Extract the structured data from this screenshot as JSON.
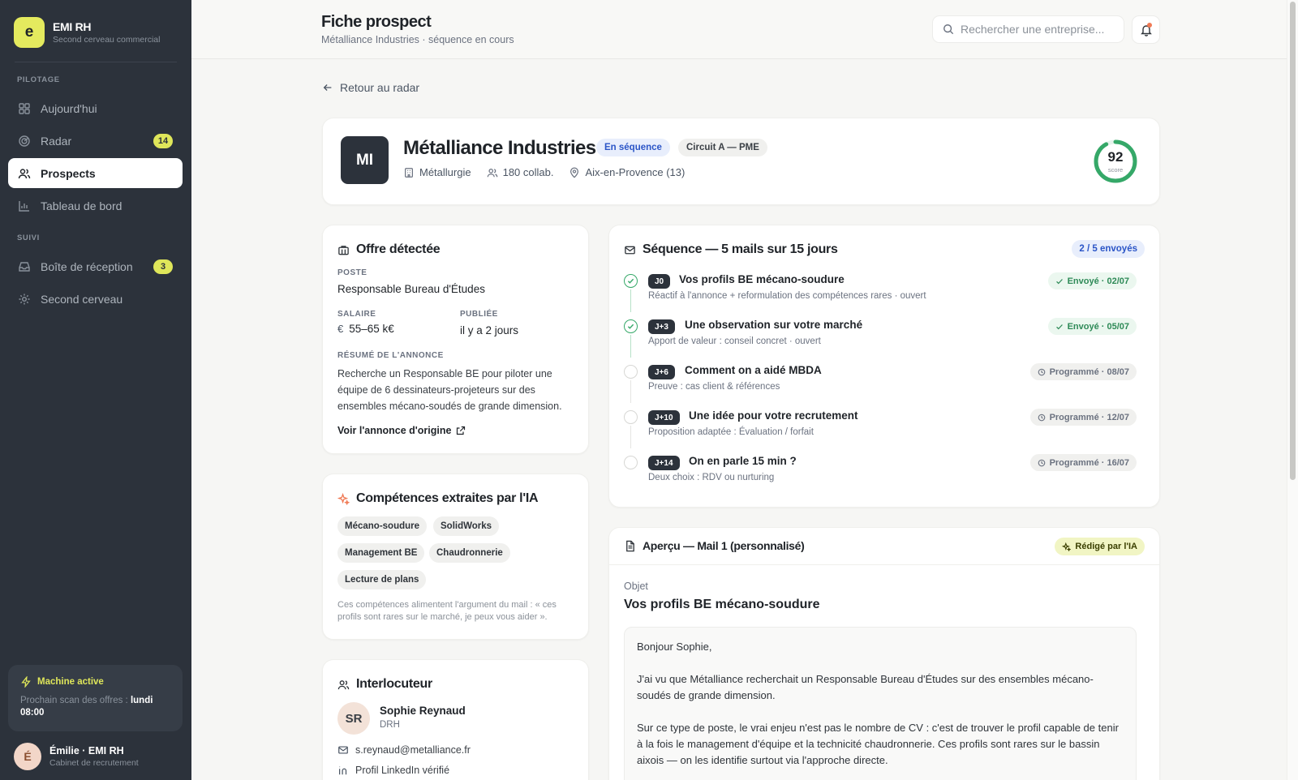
{
  "app": {
    "logo_letter": "e",
    "name": "EMI RH",
    "tagline": "Second cerveau commercial"
  },
  "sidebar": {
    "sections": [
      {
        "label": "PILOTAGE",
        "items": [
          {
            "label": "Aujourd'hui",
            "icon": "grid-icon"
          },
          {
            "label": "Radar",
            "icon": "radar-icon",
            "badge": "14"
          },
          {
            "label": "Prospects",
            "icon": "users-icon",
            "active": true
          },
          {
            "label": "Tableau de bord",
            "icon": "chart-icon"
          }
        ]
      },
      {
        "label": "SUIVI",
        "items": [
          {
            "label": "Boîte de réception",
            "icon": "inbox-icon",
            "badge": "3"
          },
          {
            "label": "Second cerveau",
            "icon": "gear-icon"
          }
        ]
      }
    ],
    "machine": {
      "title": "Machine active",
      "text": "Prochain scan des offres :",
      "time": "lundi 08:00"
    },
    "user": {
      "initial": "É",
      "name": "Émilie · EMI RH",
      "role": "Cabinet de recrutement"
    }
  },
  "header": {
    "title": "Fiche prospect",
    "subtitle": "Métalliance Industries · séquence en cours",
    "search_placeholder": "Rechercher une entreprise..."
  },
  "back_label": "Retour au radar",
  "company": {
    "initials": "MI",
    "name": "Métalliance Industries",
    "status_pill": "En séquence",
    "circuit_pill": "Circuit A — PME",
    "sector": "Métallurgie",
    "employees": "180 collab.",
    "location": "Aix-en-Provence (13)",
    "score": 92,
    "score_label": "score",
    "score_color": "#35a868"
  },
  "offer": {
    "title": "Offre détectée",
    "poste_label": "POSTE",
    "poste": "Responsable Bureau d'Études",
    "salaire_label": "SALAIRE",
    "salaire": "55–65 k€",
    "publiee_label": "PUBLIÉE",
    "publiee": "il y a 2 jours",
    "resume_label": "RÉSUMÉ DE L'ANNONCE",
    "resume": "Recherche un Responsable BE pour piloter une équipe de 6 dessinateurs-projeteurs sur des ensembles mécano-soudés de grande dimension.",
    "link": "Voir l'annonce d'origine"
  },
  "skills": {
    "title": "Compétences extraites par l'IA",
    "chips": [
      "Mécano-soudure",
      "SolidWorks",
      "Management BE",
      "Chaudronnerie",
      "Lecture de plans"
    ],
    "note": "Ces compétences alimentent l'argument du mail : « ces profils sont rares sur le marché, je peux vous aider »."
  },
  "contact": {
    "title": "Interlocuteur",
    "initials": "SR",
    "name": "Sophie Reynaud",
    "role": "DRH",
    "email": "s.reynaud@metalliance.fr",
    "linkedin": "Profil LinkedIn vérifié"
  },
  "sequence": {
    "title": "Séquence — 5 mails sur 15 jours",
    "count": "2 / 5 envoyés",
    "steps": [
      {
        "tag": "J0",
        "title": "Vos profils BE mécano-soudure",
        "desc": "Réactif à l'annonce + reformulation des compétences rares · ouvert",
        "status": "Envoyé · 02/07",
        "done": true
      },
      {
        "tag": "J+3",
        "title": "Une observation sur votre marché",
        "desc": "Apport de valeur : conseil concret · ouvert",
        "status": "Envoyé · 05/07",
        "done": true
      },
      {
        "tag": "J+6",
        "title": "Comment on a aidé MBDA",
        "desc": "Preuve : cas client & références",
        "status": "Programmé · 08/07",
        "done": false
      },
      {
        "tag": "J+10",
        "title": "Une idée pour votre recrutement",
        "desc": "Proposition adaptée : Évaluation / forfait",
        "status": "Programmé · 12/07",
        "done": false
      },
      {
        "tag": "J+14",
        "title": "On en parle 15 min ?",
        "desc": "Deux choix : RDV ou nurturing",
        "status": "Programmé · 16/07",
        "done": false
      }
    ]
  },
  "preview": {
    "title": "Aperçu — Mail 1 (personnalisé)",
    "ai_pill": "Rédigé par l'IA",
    "object_label": "Objet",
    "object": "Vos profils BE mécano-soudure",
    "greeting": "Bonjour Sophie,",
    "p1": "J'ai vu que Métalliance recherchait un Responsable Bureau d'Études sur des ensembles mécano-soudés de grande dimension.",
    "p2": "Sur ce type de poste, le vrai enjeu n'est pas le nombre de CV : c'est de trouver le profil capable de tenir à la fois le management d'équipe et la technicité chaudronnerie. Ces profils sont rares sur le bassin aixois — on les identifie surtout via l'approche directe."
  }
}
